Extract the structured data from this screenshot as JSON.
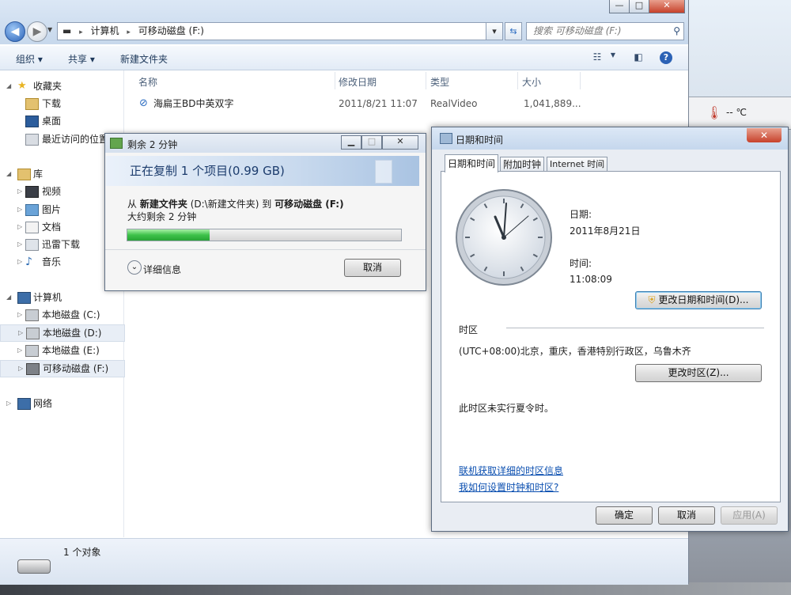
{
  "explorer": {
    "window_controls": {
      "minimize": "—",
      "maximize": "□",
      "close": "✕"
    },
    "address_path": [
      "计算机",
      "可移动磁盘 (F:)"
    ],
    "search_placeholder": "搜索 可移动磁盘 (F:)",
    "toolbar": {
      "organize": "组织 ▾",
      "share": "共享 ▾",
      "new_folder": "新建文件夹"
    },
    "nav": {
      "favorites": "收藏夹",
      "downloads": "下载",
      "desktop": "桌面",
      "recent": "最近访问的位置",
      "libraries": "库",
      "videos": "视频",
      "pictures": "图片",
      "documents": "文档",
      "xunlei": "迅雷下载",
      "music": "音乐",
      "computer": "计算机",
      "drive_c": "本地磁盘 (C:)",
      "drive_d": "本地磁盘 (D:)",
      "drive_e": "本地磁盘 (E:)",
      "drive_f": "可移动磁盘 (F:)",
      "network": "网络"
    },
    "columns": {
      "name": "名称",
      "modified": "修改日期",
      "type": "类型",
      "size": "大小"
    },
    "files": [
      {
        "name": "海扁王BD中英双字",
        "modified": "2011/8/21 11:07",
        "type": "RealVideo",
        "size": "1,041,889..."
      }
    ],
    "status": "1 个对象"
  },
  "copy_dialog": {
    "title": "剩余 2 分钟",
    "heading": "正在复制 1 个项目(0.99 GB)",
    "from_label": "从",
    "from_name": "新建文件夹",
    "from_path": "(D:\\新建文件夹)",
    "to_label": "到",
    "to_name": "可移动磁盘 (F:)",
    "remaining": "大约剩余 2 分钟",
    "progress": 0.3,
    "details": "详细信息",
    "cancel": "取消"
  },
  "datetime_dialog": {
    "title": "日期和时间",
    "tabs": [
      "日期和时间",
      "附加时钟",
      "Internet 时间"
    ],
    "date_label": "日期:",
    "date_value": "2011年8月21日",
    "time_label": "时间:",
    "time_value": "11:08:09",
    "change_datetime": "更改日期和时间(D)...",
    "timezone_section": "时区",
    "timezone_value": "(UTC+08:00)北京，重庆，香港特别行政区，乌鲁木齐",
    "change_timezone": "更改时区(Z)...",
    "dst_note": "此时区未实行夏令时。",
    "link_online": "联机获取详细的时区信息",
    "link_howto": "我如何设置时钟和时区?",
    "ok": "确定",
    "cancel": "取消",
    "apply": "应用(A)"
  },
  "background": {
    "temp_unit": "-- ℃"
  }
}
